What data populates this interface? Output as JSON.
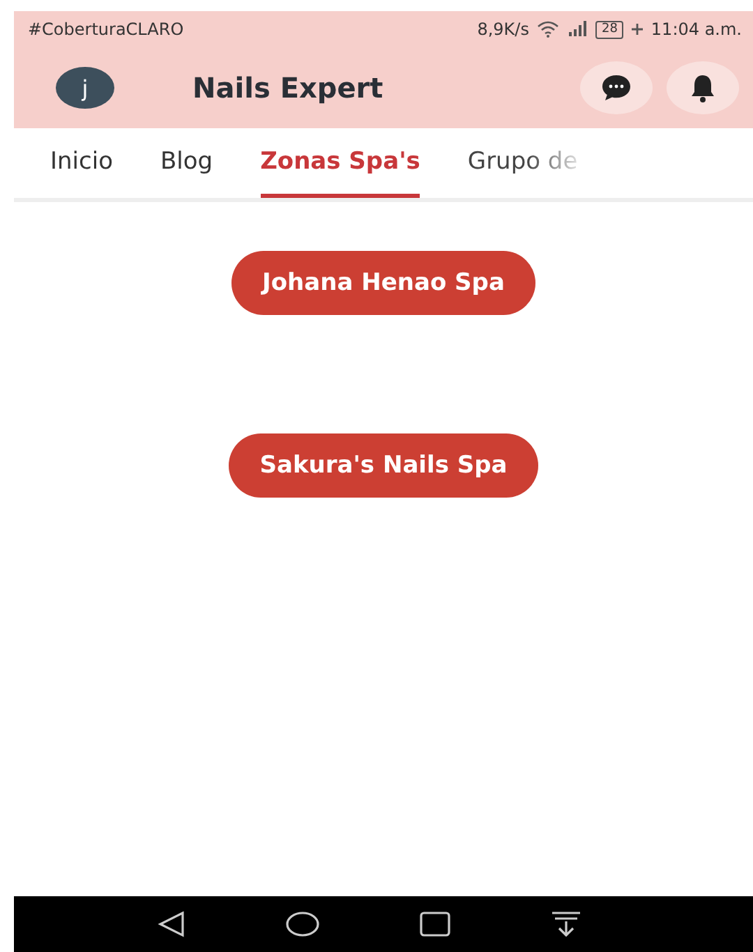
{
  "status_bar": {
    "carrier": "#CoberturaCLARO",
    "speed": "8,9K/s",
    "battery": "28",
    "time": "11:04 a.m."
  },
  "app_bar": {
    "avatar": "j",
    "title": "Nails Expert"
  },
  "tabs": [
    {
      "label": "Inicio",
      "selected": false
    },
    {
      "label": "Blog",
      "selected": false
    },
    {
      "label": "Zonas Spa's",
      "selected": true
    },
    {
      "label": "Grupo de",
      "selected": false
    }
  ],
  "spas": [
    {
      "label": "Johana Henao Spa"
    },
    {
      "label": "Sakura's Nails Spa"
    }
  ]
}
